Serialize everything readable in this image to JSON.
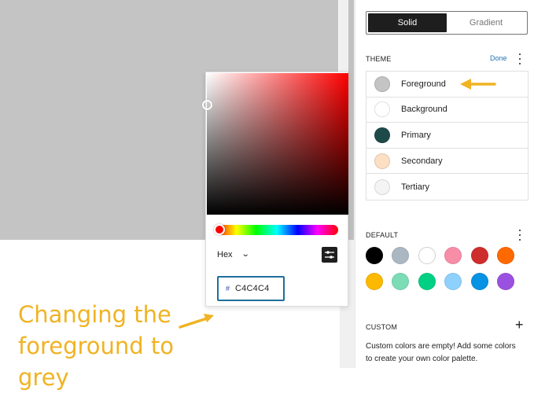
{
  "color_picker": {
    "format_label": "Hex",
    "hex_prefix": "#",
    "hex_value": "C4C4C4",
    "current_color": "#c4c4c4",
    "hue": "red"
  },
  "annotation": {
    "text_line1": "Changing the",
    "text_line2": "foreground to",
    "text_line3": "grey",
    "color": "#f0b323"
  },
  "sidebar": {
    "tabs": [
      {
        "label": "Solid",
        "active": true
      },
      {
        "label": "Gradient",
        "active": false
      }
    ],
    "theme": {
      "heading": "THEME",
      "done_label": "Done",
      "items": [
        {
          "label": "Foreground",
          "color": "#c4c4c4"
        },
        {
          "label": "Background",
          "color": "#ffffff"
        },
        {
          "label": "Primary",
          "color": "#1f4a4a"
        },
        {
          "label": "Secondary",
          "color": "#fde0c4"
        },
        {
          "label": "Tertiary",
          "color": "#f4f4f4"
        }
      ]
    },
    "default": {
      "heading": "DEFAULT",
      "colors": [
        {
          "name": "Black",
          "hex": "#000000"
        },
        {
          "name": "Cyan bluish gray",
          "hex": "#abb8c3"
        },
        {
          "name": "White",
          "hex": "#ffffff"
        },
        {
          "name": "Pale pink",
          "hex": "#f78da7"
        },
        {
          "name": "Vivid red",
          "hex": "#cf2e2e"
        },
        {
          "name": "Luminous vivid orange",
          "hex": "#ff6900"
        },
        {
          "name": "Luminous vivid amber",
          "hex": "#fcb900"
        },
        {
          "name": "Light green cyan",
          "hex": "#7bdcb5"
        },
        {
          "name": "Vivid green cyan",
          "hex": "#00d084"
        },
        {
          "name": "Pale cyan blue",
          "hex": "#8ed1fc"
        },
        {
          "name": "Vivid cyan blue",
          "hex": "#0693e3"
        },
        {
          "name": "Vivid purple",
          "hex": "#9b51e0"
        }
      ]
    },
    "custom": {
      "heading": "CUSTOM",
      "add_label": "+",
      "empty_line1": "Custom colors are empty! Add some colors",
      "empty_line2": "to create your own color palette."
    }
  }
}
